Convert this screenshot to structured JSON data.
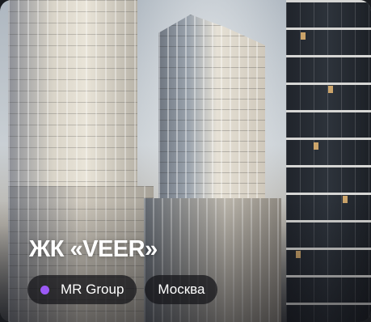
{
  "card": {
    "title": "ЖК «VEER»",
    "developer": {
      "label": "MR Group",
      "dot_color": "#9b59f5"
    },
    "location": {
      "label": "Москва"
    }
  }
}
